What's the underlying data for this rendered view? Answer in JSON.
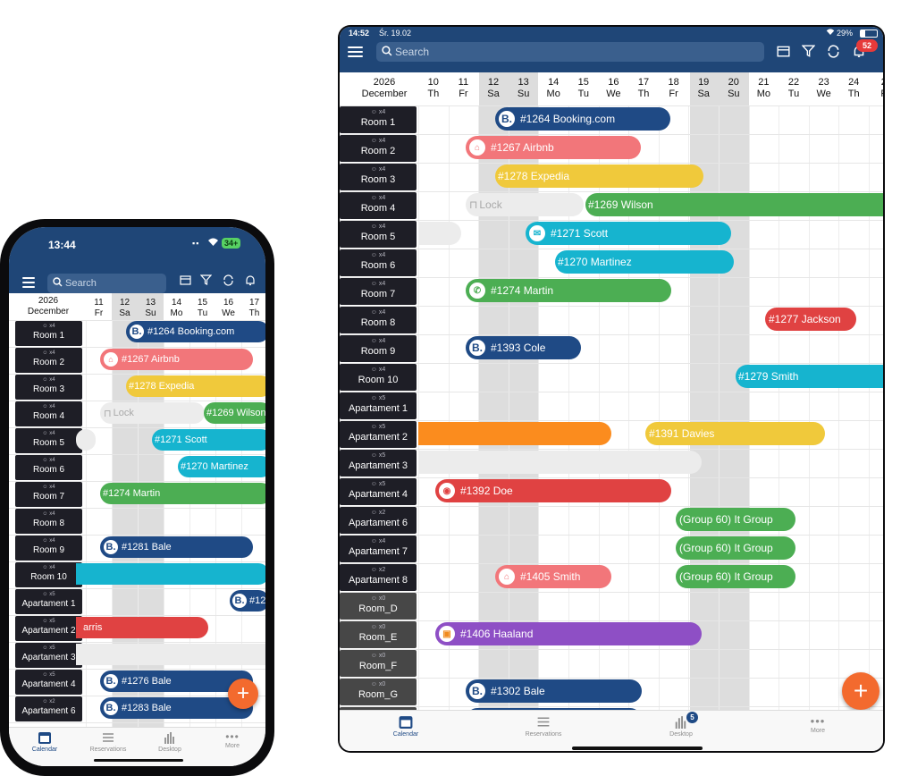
{
  "phone": {
    "time": "13:44",
    "battery": "34+",
    "search_placeholder": "Search",
    "date_header": {
      "year": "2026",
      "month": "December"
    },
    "days": [
      {
        "num": "11",
        "wd": "Fr"
      },
      {
        "num": "12",
        "wd": "Sa"
      },
      {
        "num": "13",
        "wd": "Su"
      },
      {
        "num": "14",
        "wd": "Mo"
      },
      {
        "num": "15",
        "wd": "Tu"
      },
      {
        "num": "16",
        "wd": "We"
      },
      {
        "num": "17",
        "wd": "Th"
      }
    ],
    "rooms": [
      {
        "cap": "x4",
        "name": "Room 1"
      },
      {
        "cap": "x4",
        "name": "Room 2"
      },
      {
        "cap": "x4",
        "name": "Room 3"
      },
      {
        "cap": "x4",
        "name": "Room 4"
      },
      {
        "cap": "x4",
        "name": "Room 5"
      },
      {
        "cap": "x4",
        "name": "Room 6"
      },
      {
        "cap": "x4",
        "name": "Room 7"
      },
      {
        "cap": "x4",
        "name": "Room 8"
      },
      {
        "cap": "x4",
        "name": "Room 9"
      },
      {
        "cap": "x4",
        "name": "Room 10"
      },
      {
        "cap": "x5",
        "name": "Apartament 1"
      },
      {
        "cap": "x5",
        "name": "Apartament 2"
      },
      {
        "cap": "x5",
        "name": "Apartament 3"
      },
      {
        "cap": "x5",
        "name": "Apartament 4"
      },
      {
        "cap": "x2",
        "name": "Apartament 6"
      }
    ],
    "bookings": [
      {
        "label": "#1264 Booking.com"
      },
      {
        "label": "#1267 Airbnb"
      },
      {
        "label": "#1278 Expedia"
      },
      {
        "label": "Lock"
      },
      {
        "label": "#1269 Wilson"
      },
      {
        "label": "#1271 Scott"
      },
      {
        "label": "#1270 Martinez"
      },
      {
        "label": "#1274 Martin"
      },
      {
        "label": "#1281 Bale"
      },
      {
        "label": "#12"
      },
      {
        "label": "arris"
      },
      {
        "label": "#1276 Bale"
      },
      {
        "label": "#1283 Bale"
      }
    ],
    "tabs": [
      {
        "label": "Calendar"
      },
      {
        "label": "Reservations"
      },
      {
        "label": "Desktop"
      },
      {
        "label": "More"
      }
    ]
  },
  "tablet": {
    "time": "14:52",
    "date": "Śr. 19.02",
    "battery": "29%",
    "notification_count": "52",
    "search_placeholder": "Search",
    "date_header": {
      "year": "2026",
      "month": "December"
    },
    "days": [
      {
        "num": "10",
        "wd": "Th"
      },
      {
        "num": "11",
        "wd": "Fr"
      },
      {
        "num": "12",
        "wd": "Sa"
      },
      {
        "num": "13",
        "wd": "Su"
      },
      {
        "num": "14",
        "wd": "Mo"
      },
      {
        "num": "15",
        "wd": "Tu"
      },
      {
        "num": "16",
        "wd": "We"
      },
      {
        "num": "17",
        "wd": "Th"
      },
      {
        "num": "18",
        "wd": "Fr"
      },
      {
        "num": "19",
        "wd": "Sa"
      },
      {
        "num": "20",
        "wd": "Su"
      },
      {
        "num": "21",
        "wd": "Mo"
      },
      {
        "num": "22",
        "wd": "Tu"
      },
      {
        "num": "23",
        "wd": "We"
      },
      {
        "num": "24",
        "wd": "Th"
      },
      {
        "num": "2",
        "wd": "F"
      }
    ],
    "rooms": [
      {
        "cap": "x4",
        "name": "Room 1"
      },
      {
        "cap": "x4",
        "name": "Room 2"
      },
      {
        "cap": "x4",
        "name": "Room 3"
      },
      {
        "cap": "x4",
        "name": "Room 4"
      },
      {
        "cap": "x4",
        "name": "Room 5"
      },
      {
        "cap": "x4",
        "name": "Room 6"
      },
      {
        "cap": "x4",
        "name": "Room 7"
      },
      {
        "cap": "x4",
        "name": "Room 8"
      },
      {
        "cap": "x4",
        "name": "Room 9"
      },
      {
        "cap": "x4",
        "name": "Room 10"
      },
      {
        "cap": "x5",
        "name": "Apartament 1"
      },
      {
        "cap": "x5",
        "name": "Apartament 2"
      },
      {
        "cap": "x5",
        "name": "Apartament 3"
      },
      {
        "cap": "x5",
        "name": "Apartament 4"
      },
      {
        "cap": "x2",
        "name": "Apartament 6"
      },
      {
        "cap": "x4",
        "name": "Apartament 7"
      },
      {
        "cap": "x2",
        "name": "Apartament 8"
      },
      {
        "cap": "x0",
        "name": "Room_D"
      },
      {
        "cap": "x0",
        "name": "Room_E"
      },
      {
        "cap": "x0",
        "name": "Room_F"
      },
      {
        "cap": "x0",
        "name": "Room_G"
      },
      {
        "cap": "x5",
        "name": ""
      }
    ],
    "bookings": [
      {
        "label": "#1264 Booking.com"
      },
      {
        "label": "#1267 Airbnb"
      },
      {
        "label": "#1278 Expedia"
      },
      {
        "label": "Lock"
      },
      {
        "label": "#1269 Wilson"
      },
      {
        "label": "#1271 Scott"
      },
      {
        "label": "#1270 Martinez"
      },
      {
        "label": "#1274 Martin"
      },
      {
        "label": "#1277 Jackson"
      },
      {
        "label": "#1393 Cole"
      },
      {
        "label": "#1279 Smith"
      },
      {
        "label": "#1391 Davies"
      },
      {
        "label": "#1392 Doe"
      },
      {
        "label": "(Group 60) It Group"
      },
      {
        "label": "(Group 60) It Group"
      },
      {
        "label": "(Group 60) It Group"
      },
      {
        "label": "#1405 Smith"
      },
      {
        "label": "#1406 Haaland"
      },
      {
        "label": "#1302 Bale"
      }
    ],
    "tabs": [
      {
        "label": "Calendar"
      },
      {
        "label": "Reservations"
      },
      {
        "label": "Desktop",
        "badge": "5"
      },
      {
        "label": "More"
      }
    ]
  }
}
